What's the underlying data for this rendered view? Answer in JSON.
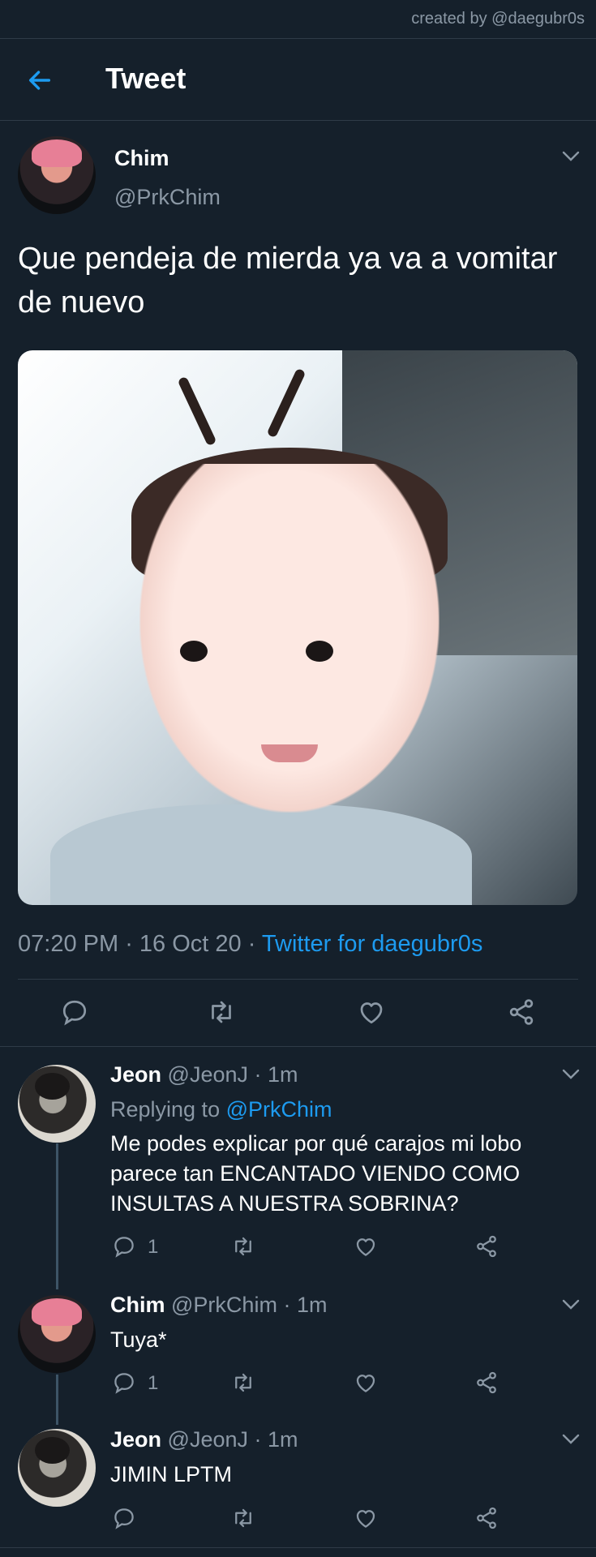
{
  "watermark": "created by @daegubr0s",
  "header": {
    "title": "Tweet",
    "back_icon": "arrow-left-icon"
  },
  "colors": {
    "background": "#15202b",
    "accent": "#1d9bf0",
    "muted": "#8b98a5",
    "divider": "#2f3b47"
  },
  "main_tweet": {
    "author": {
      "name": "Chim",
      "handle": "@PrkChim"
    },
    "text": "Que pendeja de mierda ya va a vomitar de nuevo",
    "time": "07:20 PM",
    "sep1": " · ",
    "date": "16 Oct 20",
    "sep2": " · ",
    "source": "Twitter for daegubr0s",
    "actions": [
      "reply-icon",
      "retweet-icon",
      "like-icon",
      "share-icon"
    ]
  },
  "replies": [
    {
      "name": "Jeon",
      "handle": "@JeonJ",
      "sep": " · ",
      "time": "1m",
      "replying_label": "Replying to ",
      "replying_to": "@PrkChim",
      "text": "Me podes explicar por qué carajos mi lobo parece tan ENCANTADO VIENDO COMO INSULTAS A NUESTRA SOBRINA?",
      "reply_count": "1"
    },
    {
      "name": "Chim",
      "handle": "@PrkChim",
      "sep": " · ",
      "time": "1m",
      "text": "Tuya*",
      "reply_count": "1"
    },
    {
      "name": "Jeon",
      "handle": "@JeonJ",
      "sep": " · ",
      "time": "1m",
      "text": "JIMIN LPTM"
    }
  ]
}
